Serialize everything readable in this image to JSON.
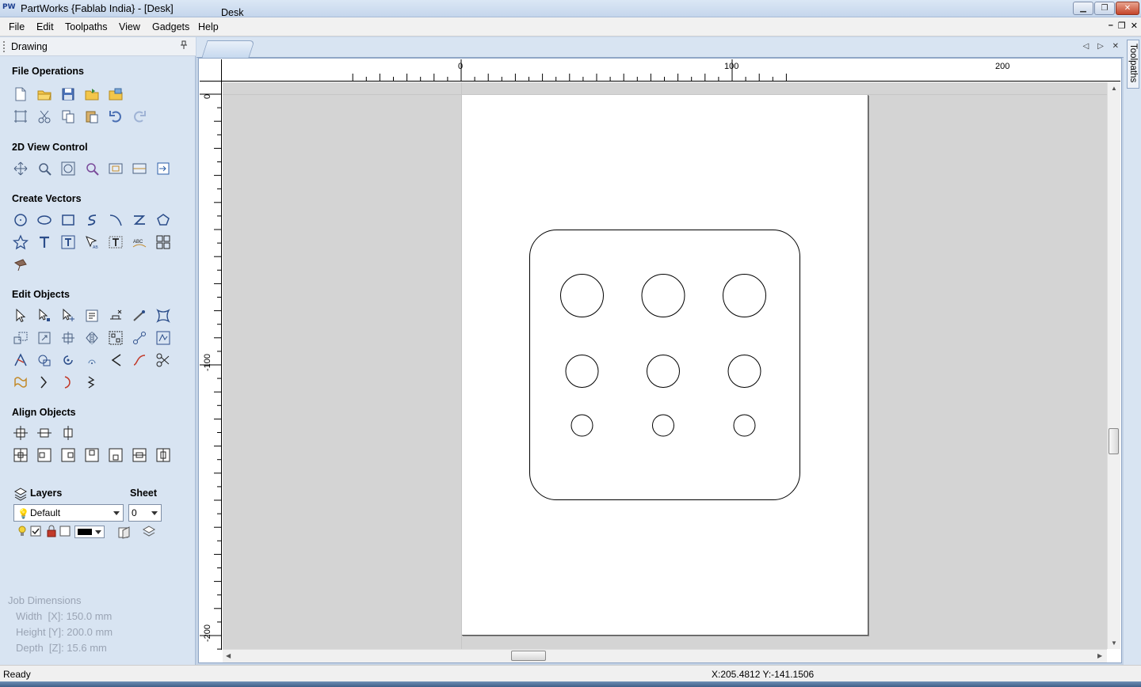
{
  "window": {
    "app_logo": "PW",
    "title": "PartWorks {Fablab India} - [Desk]",
    "buttons": {
      "minimize": "▁",
      "restore": "❐",
      "close": "✕"
    }
  },
  "menu": {
    "items": [
      "File",
      "Edit",
      "Toolpaths",
      "View",
      "Gadgets",
      "Help"
    ],
    "mdi": {
      "minimize": "–",
      "restore": "❐",
      "close": "✕"
    }
  },
  "panel": {
    "title": "Drawing",
    "pin_icon": "📌",
    "sections": {
      "file_operations": "File Operations",
      "view_control": "2D View Control",
      "create_vectors": "Create Vectors",
      "edit_objects": "Edit Objects",
      "align_objects": "Align Objects"
    },
    "layers": {
      "title": "Layers",
      "selected": "Default",
      "sheet_title": "Sheet",
      "sheet_value": "0"
    },
    "job_dimensions": {
      "title": "Job Dimensions",
      "width": "Width  [X]: 150.0 mm",
      "height": "Height [Y]: 200.0 mm",
      "depth": "Depth  [Z]: 15.6 mm"
    }
  },
  "document_tab": {
    "label": "Desk",
    "nav": "◁ ▷ ✕"
  },
  "right_tab": {
    "label": "Toolpaths"
  },
  "rulers": {
    "top": [
      "0",
      "100",
      "200"
    ],
    "left": [
      "0",
      "-100",
      "-200"
    ]
  },
  "status": {
    "text": "Ready",
    "coords": "X:205.4812 Y:-141.1506"
  },
  "colors": {
    "panel_bg": "#d8e4f2",
    "canvas_bg": "#d4d4d4",
    "sheet_bg": "#ffffff",
    "vector_stroke": "#000000"
  }
}
